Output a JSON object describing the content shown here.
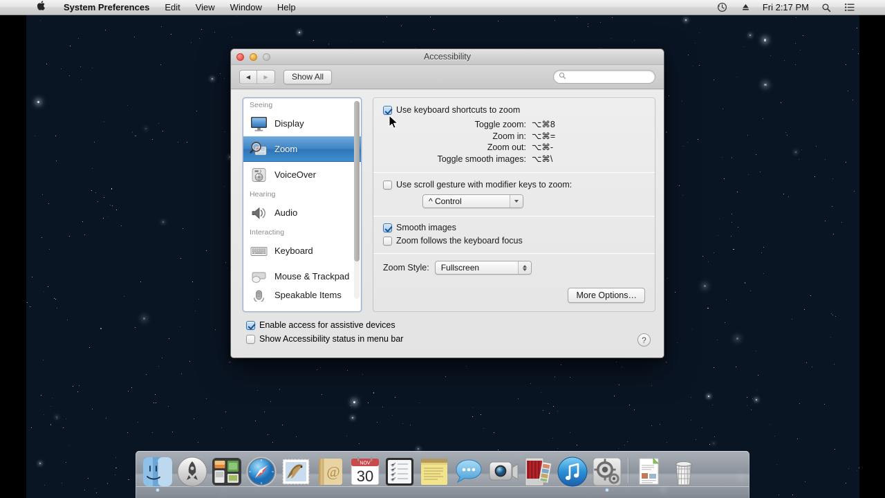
{
  "menubar": {
    "apple_icon": "apple-logo",
    "items": [
      {
        "label": "System Preferences",
        "bold": true
      },
      {
        "label": "Edit",
        "bold": false
      },
      {
        "label": "View",
        "bold": false
      },
      {
        "label": "Window",
        "bold": false
      },
      {
        "label": "Help",
        "bold": false
      }
    ],
    "status": {
      "timemachine_icon": "clock-arrow-icon",
      "eject_icon": "eject-icon",
      "clock": "Fri 2:17 PM",
      "spotlight_icon": "search-icon",
      "notification_icon": "list-lines-icon"
    }
  },
  "window": {
    "title": "Accessibility",
    "traffic_lights": {
      "close": "close-button",
      "minimize": "minimize-button",
      "zoom": "zoom-button"
    },
    "toolbar": {
      "back_label": "◀",
      "forward_label": "▶",
      "show_all_label": "Show All",
      "search_placeholder": "",
      "search_value": ""
    }
  },
  "sidebar": {
    "groups": [
      {
        "header": "Seeing",
        "items": [
          {
            "label": "Display",
            "icon": "display-icon",
            "selected": false
          },
          {
            "label": "Zoom",
            "icon": "zoom-magnifier-icon",
            "selected": true
          },
          {
            "label": "VoiceOver",
            "icon": "voiceover-icon",
            "selected": false
          }
        ]
      },
      {
        "header": "Hearing",
        "items": [
          {
            "label": "Audio",
            "icon": "speaker-icon",
            "selected": false
          }
        ]
      },
      {
        "header": "Interacting",
        "items": [
          {
            "label": "Keyboard",
            "icon": "keyboard-icon",
            "selected": false
          },
          {
            "label": "Mouse & Trackpad",
            "icon": "mouse-icon",
            "selected": false
          },
          {
            "label": "Speakable Items",
            "icon": "microphone-icon",
            "selected": false
          }
        ]
      }
    ]
  },
  "pane": {
    "use_keyboard_shortcuts": {
      "label": "Use keyboard shortcuts to zoom",
      "checked": true
    },
    "shortcuts": [
      {
        "label": "Toggle zoom:",
        "keys": "⌥⌘8"
      },
      {
        "label": "Zoom in:",
        "keys": "⌥⌘="
      },
      {
        "label": "Zoom out:",
        "keys": "⌥⌘-"
      },
      {
        "label": "Toggle smooth images:",
        "keys": "⌥⌘\\"
      }
    ],
    "scroll_gesture": {
      "label": "Use scroll gesture with modifier keys to zoom:",
      "checked": false
    },
    "modifier_popup": {
      "value": "^ Control"
    },
    "smooth_images": {
      "label": "Smooth images",
      "checked": true
    },
    "follows_focus": {
      "label": "Zoom follows the keyboard focus",
      "checked": false
    },
    "zoom_style": {
      "label": "Zoom Style:",
      "value": "Fullscreen"
    },
    "more_options": {
      "label": "More Options…"
    }
  },
  "bottom": {
    "enable_assistive": {
      "label": "Enable access for assistive devices",
      "checked": true
    },
    "show_status": {
      "label": "Show Accessibility status in menu bar",
      "checked": false
    },
    "help_label": "?"
  },
  "dock": {
    "items": [
      {
        "name": "finder",
        "label": "Finder",
        "running": true
      },
      {
        "name": "launchpad",
        "label": "Launchpad",
        "running": false
      },
      {
        "name": "mission-control",
        "label": "Mission Control",
        "running": false
      },
      {
        "name": "safari",
        "label": "Safari",
        "running": false
      },
      {
        "name": "mail",
        "label": "Mail",
        "running": false
      },
      {
        "name": "contacts",
        "label": "Contacts",
        "running": false
      },
      {
        "name": "calendar",
        "label": "Calendar",
        "running": false
      },
      {
        "name": "reminders",
        "label": "Reminders",
        "running": false
      },
      {
        "name": "notes",
        "label": "Notes",
        "running": false
      },
      {
        "name": "messages",
        "label": "Messages",
        "running": false
      },
      {
        "name": "facetime",
        "label": "FaceTime",
        "running": false
      },
      {
        "name": "photo-booth",
        "label": "Photo Booth",
        "running": false
      },
      {
        "name": "itunes",
        "label": "iTunes",
        "running": false
      },
      {
        "name": "system-preferences",
        "label": "System Preferences",
        "running": true
      },
      {
        "name": "separator",
        "label": "",
        "running": false
      },
      {
        "name": "documents-stack",
        "label": "Documents",
        "running": false
      },
      {
        "name": "trash",
        "label": "Trash",
        "running": false
      }
    ],
    "calendar_day": "30",
    "calendar_month": "NOV"
  },
  "colors": {
    "selection_blue": "#3e85c6",
    "menubar_text": "#111111",
    "window_bg": "#ececec",
    "desktop_top": "#05080f",
    "desktop_bottom": "#234a63"
  }
}
